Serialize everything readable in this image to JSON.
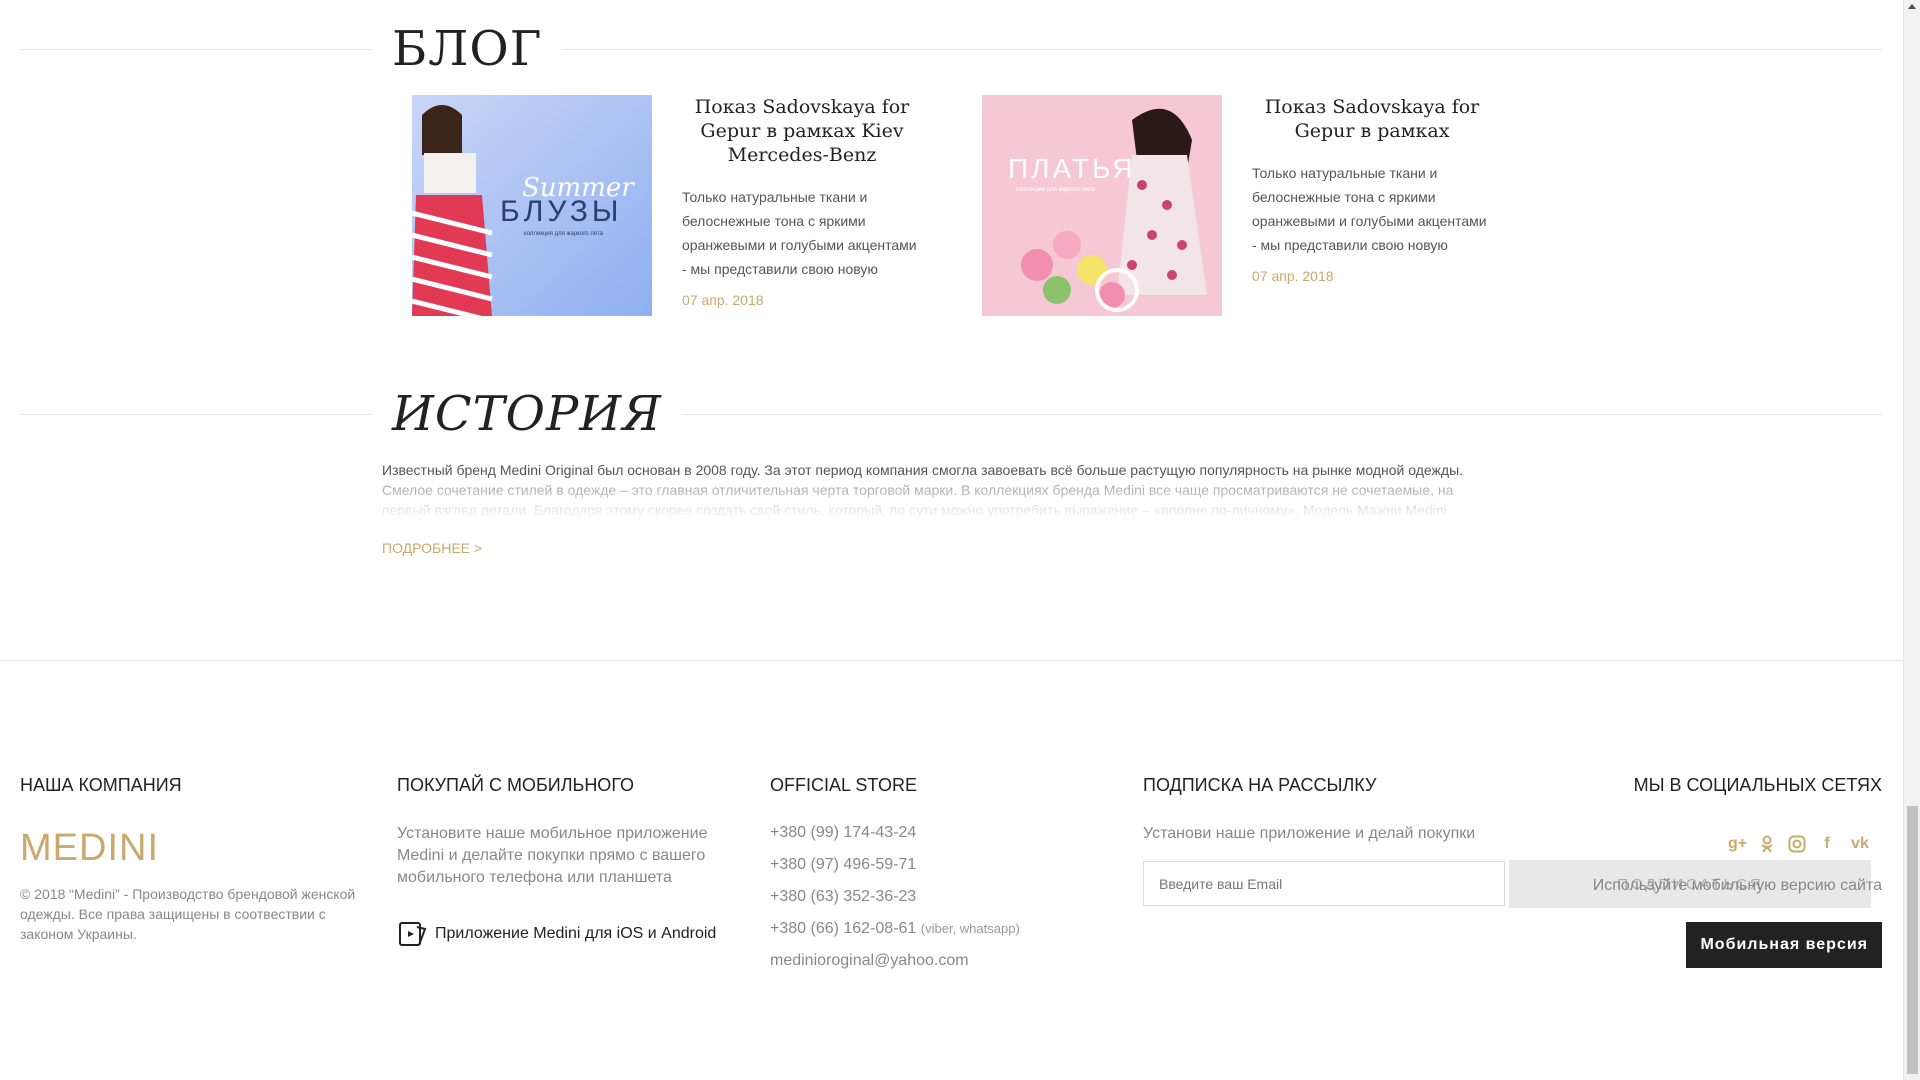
{
  "blog": {
    "title": "БЛОГ",
    "posts": [
      {
        "image_text_1": "Summer",
        "image_text_2": "БЛУЗЫ",
        "image_text_3": "коллекция для жаркого лета",
        "title": "Показ Sadovskaya for Gepur в рамках Kiev Mercedes-Benz",
        "desc": "Только натуральные ткани и белоснежные тона с яркими оранжевыми и голубыми акцентами - мы представили свою новую",
        "date": "07 апр. 2018"
      },
      {
        "image_text_1": "ПЛАТЬЯ",
        "image_text_2": "коллекция для жаркого лета",
        "title": "Показ Sadovskaya for Gepur в рамках",
        "desc": "Только натуральные ткани и белоснежные тона с яркими оранжевыми и голубыми акцентами - мы представили свою новую",
        "date": "07 апр. 2018"
      }
    ]
  },
  "history": {
    "title": "ИСТОРИЯ",
    "text": "Известный бренд Medini Original был основан в 2008 году. За этот период компания смогла завоевать всё больше растущую популярность на рынке модной одежды. Смелое сочетание стилей в одежде – это главная отличительная черта торговой марки. В коллекциях бренда Medini все чаще просматриваются не сочетаемые, на первый взгляд детали. Благодаря этому скорее создать свой стиль, который, по сути можно употребить выражение – «вполне по-личному». Модель Мажни Medini",
    "more": "ПОДРОБНЕЕ >"
  },
  "footer": {
    "company": {
      "heading": "НАША КОМПАНИЯ",
      "logo": "MEDINI",
      "copyright": "© 2018 “Medini” - Производство брендовой женской одежды. Все права защищены в соотвествии с законом Украины."
    },
    "mobile": {
      "heading": "ПОКУПАЙ С МОБИЛЬНОГО",
      "text": "Установите наше мобильное приложение Medini и делайте покупки прямо с вашего мобильного телефона или планшета",
      "app_link": "Приложение Medini для iOS и Android"
    },
    "store": {
      "heading": "OFFICIAL STORE",
      "phones": [
        "+380 (99) 174-43-24",
        "+380 (97) 496-59-71",
        "+380 (63) 352-36-23",
        "+380 (66) 162-08-61"
      ],
      "phone_note": "(viber, whatsapp)",
      "email": "medinioroginal@yahoo.com"
    },
    "subscribe": {
      "heading": "ПОДПИСКА НА РАССЫЛКУ",
      "text": "Установи наше приложение и делай покупки",
      "placeholder": "Введите ваш Email",
      "button": "ПОДПИСАТЬСЯ"
    },
    "social": {
      "heading": "МЫ В СОЦИАЛЬНЫХ СЕТЯХ",
      "icons": [
        "google-plus-icon",
        "odnoklassniki-icon",
        "instagram-icon",
        "facebook-icon",
        "vk-icon"
      ],
      "text": "Используйте мобильную версию сайта",
      "button": "Мобильная версия"
    }
  },
  "colors": {
    "accent": "#c9a96e",
    "dark": "#222222"
  }
}
